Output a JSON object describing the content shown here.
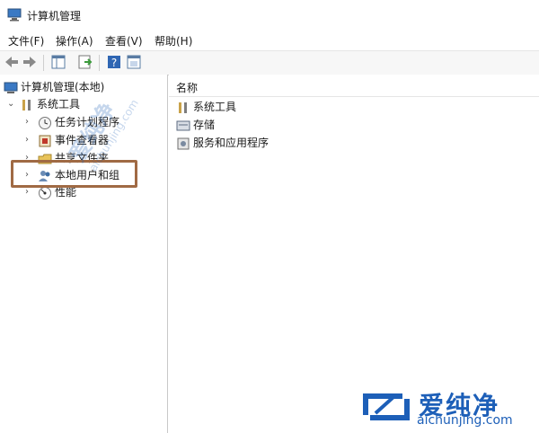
{
  "window": {
    "title": "计算机管理"
  },
  "menu": [
    "文件(F)",
    "操作(A)",
    "查看(V)",
    "帮助(H)"
  ],
  "toolbar": {
    "buttons": [
      "back-arrow-icon",
      "forward-arrow-icon",
      "show-hide-tree-icon",
      "export-list-icon",
      "help-icon",
      "properties-icon"
    ]
  },
  "tree": {
    "root": "计算机管理(本地)",
    "system_tools": "系统工具",
    "task_scheduler": "任务计划程序",
    "event_viewer": "事件查看器",
    "shared_folders": "共享文件夹",
    "local_users": "本地用户和组",
    "performance": "性能"
  },
  "list": {
    "column": "名称",
    "items": [
      "系统工具",
      "存储",
      "服务和应用程序"
    ]
  },
  "watermark": {
    "brand": "爱纯净",
    "url": "aichunjing.com"
  },
  "colors": {
    "highlight": "#a06a44",
    "brand": "#1d5fb8"
  }
}
